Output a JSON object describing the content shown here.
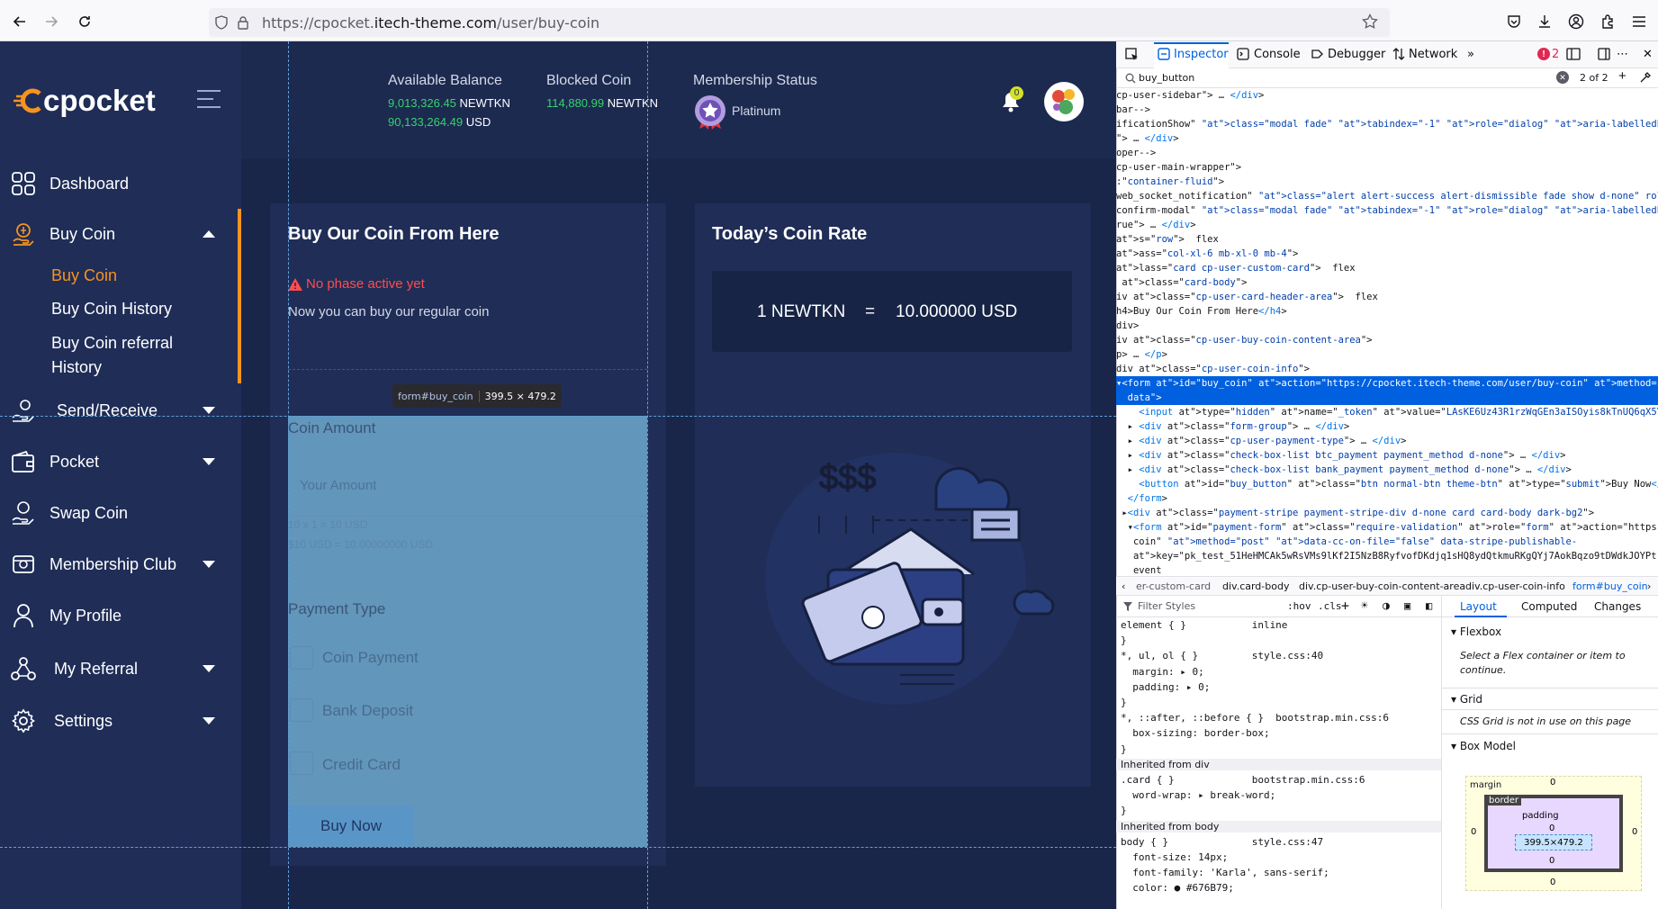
{
  "browser": {
    "url_prefix": "https://cpocket.",
    "url_domain": "itech-theme.com",
    "url_path": "/user/buy-coin"
  },
  "app": {
    "logo": "cpocket",
    "header": {
      "available_balance_label": "Available Balance",
      "available_balance_value": "9,013,326.45",
      "available_balance_unit": "NEWTKN",
      "available_usd_value": "90,133,264.49",
      "available_usd_unit": "USD",
      "blocked_coin_label": "Blocked Coin",
      "blocked_coin_value": "114,880.99",
      "blocked_coin_unit": "NEWTKN",
      "membership_label": "Membership Status",
      "membership_value": "Platinum",
      "notification_count": "0"
    },
    "sidebar": {
      "items": [
        {
          "label": "Dashboard",
          "icon": "dashboard-icon"
        },
        {
          "label": "Buy Coin",
          "icon": "buy-coin-icon"
        },
        {
          "label": "Send/Receive",
          "icon": "send-receive-icon"
        },
        {
          "label": "Pocket",
          "icon": "pocket-icon"
        },
        {
          "label": "Swap Coin",
          "icon": "swap-coin-icon"
        },
        {
          "label": "Membership Club",
          "icon": "membership-icon"
        },
        {
          "label": "My Profile",
          "icon": "profile-icon"
        },
        {
          "label": "My Referral",
          "icon": "referral-icon"
        },
        {
          "label": "Settings",
          "icon": "settings-icon"
        }
      ],
      "sub_items": [
        "Buy Coin",
        "Buy Coin History",
        "Buy Coin referral",
        "History"
      ]
    },
    "buy_card": {
      "title": "Buy Our Coin From Here",
      "warning": "No phase active yet",
      "subtitle": "Now you can buy our regular coin",
      "coin_amount_label": "Coin Amount",
      "amount_placeholder": "Your Amount",
      "calc_line1": "10 x 1 = 10 USD",
      "calc_line2": "$10 USD = 10.00000000 USD",
      "payment_type_label": "Payment Type",
      "payment_options": [
        "Coin Payment",
        "Bank Deposit",
        "Credit Card"
      ],
      "buy_button": "Buy Now"
    },
    "rate_card": {
      "title": "Today’s Coin Rate",
      "rate_left": "1 NEWTKN",
      "rate_eq": "=",
      "rate_right": "10.000000 USD"
    },
    "inspector_tooltip": {
      "selector": "form#buy_coin",
      "size": "399.5 × 479.2"
    }
  },
  "devtools": {
    "tabs": [
      "Inspector",
      "Console",
      "Debugger",
      "Network"
    ],
    "error_count": "2",
    "search_value": "buy_button",
    "search_result": "2 of 2",
    "breadcrumbs": [
      "er-custom-card",
      "div.card-body",
      "div.cp-user-buy-coin-content-area",
      "div.cp-user-coin-info",
      "form#buy_coin"
    ],
    "filter_placeholder": "Filter Styles",
    "hov": ":hov",
    "cls": ".cls",
    "layout_tabs": [
      "Layout",
      "Computed",
      "Changes"
    ],
    "flexbox_title": "Flexbox",
    "flexbox_text": "Select a Flex container or item to continue.",
    "grid_title": "Grid",
    "grid_text": "CSS Grid is not in use on this page",
    "boxmodel_title": "Box Model",
    "bm_margin": "margin",
    "bm_border": "border",
    "bm_padding": "padding",
    "bm_size": "399.5×479.2",
    "bm_zero": "0",
    "markup_lines": [
      "cp-user-sidebar\"> … </div>",
      "bar-->",
      "ificationShow\" class=\"modal fade\" tabindex=\"-1\" role=\"dialog\" aria-labelledby=\"exampleModal",
      "\"> … </div>",
      "oper-->",
      "cp-user-main-wrapper\">",
      ":\"container-fluid\">",
      "web_socket_notification\" class=\"alert alert-success alert-dismissible fade show d-none\" rol",
      "confirm-modal\" class=\"modal fade\" tabindex=\"-1\" role=\"dialog\" aria-labelledby=\"exampleModal",
      "rue\"> … </div>",
      "s=\"row\">  flex",
      "ass=\"col-xl-6 mb-xl-0 mb-4\">",
      "lass=\"card cp-user-custom-card\">  flex",
      " class=\"card-body\">",
      "iv class=\"cp-user-card-header-area\">  flex",
      "h4>Buy Our Coin From Here</h4>",
      "div>",
      "iv class=\"cp-user-buy-coin-content-area\">",
      "p> … </p>",
      "div class=\"cp-user-coin-info\">",
      "▾<form id=\"buy_coin\" action=\"https://cpocket.itech-theme.com/user/buy-coin\" method=\"POST\" e",
      "  data\">",
      "    <input type=\"hidden\" name=\"_token\" value=\"LAsKE6Uz43R1rzWqGEn3aISOyis8kTnUQ6qX5YTZ\">",
      "  ▸ <div class=\"form-group\"> … </div>",
      "  ▸ <div class=\"cp-user-payment-type\"> … </div>",
      "  ▸ <div class=\"check-box-list btc_payment payment_method d-none\"> … </div>",
      "  ▸ <div class=\"check-box-list bank_payment payment_method d-none\"> … </div>",
      "    <button id=\"buy_button\" class=\"btn normal-btn theme-btn\" type=\"submit\">Buy Now</button>",
      "  </form>",
      " ▸<div class=\"payment-stripe payment-stripe-div d-none card card-body dark-bg2\">",
      "  ▾<form id=\"payment-form\" class=\"require-validation\" role=\"form\" action=\"https://cpocket.i",
      "   coin\" method=\"post\" data-cc-on-file=\"false\" data-stripe-publishable-",
      "   key=\"pk_test_51HeHMCAk5wRsVMs9lKf2I5NzB8RyfvofDKdjq1sHQ8ydQtkmuRKgQYj7AokBqzo9tDWdkJOYPt",
      "   event"
    ],
    "rules_lines": [
      "element { }           inline",
      "}",
      "*, ul, ol { }         style.css:40",
      "  margin: ▸ 0;",
      "  padding: ▸ 0;",
      "}",
      "*, ::after, ::before { }  bootstrap.min.css:6",
      "  box-sizing: border-box;",
      "}",
      "Inherited from div",
      ".card { }             bootstrap.min.css:6",
      "  word-wrap: ▸ break-word;",
      "}",
      "Inherited from body",
      "body { }              style.css:47",
      "  font-size: 14px;",
      "  font-family: 'Karla', sans-serif;",
      "  color: ● #676B79;"
    ]
  },
  "colors": {
    "accent_orange": "#f7931e",
    "balance_green": "#37d26d",
    "warning_red": "#ff4d4d",
    "sidebar_bg": "#1f2d57"
  }
}
